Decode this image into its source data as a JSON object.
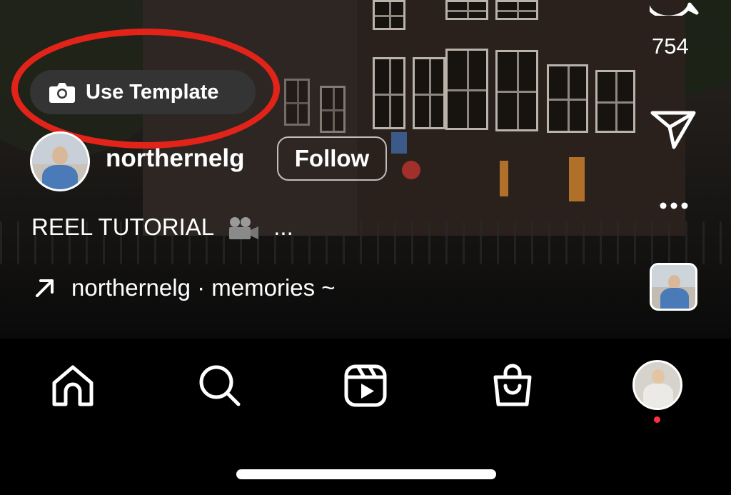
{
  "reel": {
    "use_template_label": "Use Template",
    "username": "northernelg",
    "follow_label": "Follow",
    "caption": "REEL TUTORIAL",
    "caption_more": "...",
    "audio_label": "northernelg · memories ~"
  },
  "actions": {
    "comment_count": "754"
  },
  "tabbar": {
    "items": [
      "home-icon",
      "search-icon",
      "reels-icon",
      "shop-icon",
      "profile-avatar"
    ]
  },
  "colors": {
    "highlight": "#e2231a",
    "notification_dot": "#ff3040",
    "pill_background": "#373737"
  }
}
